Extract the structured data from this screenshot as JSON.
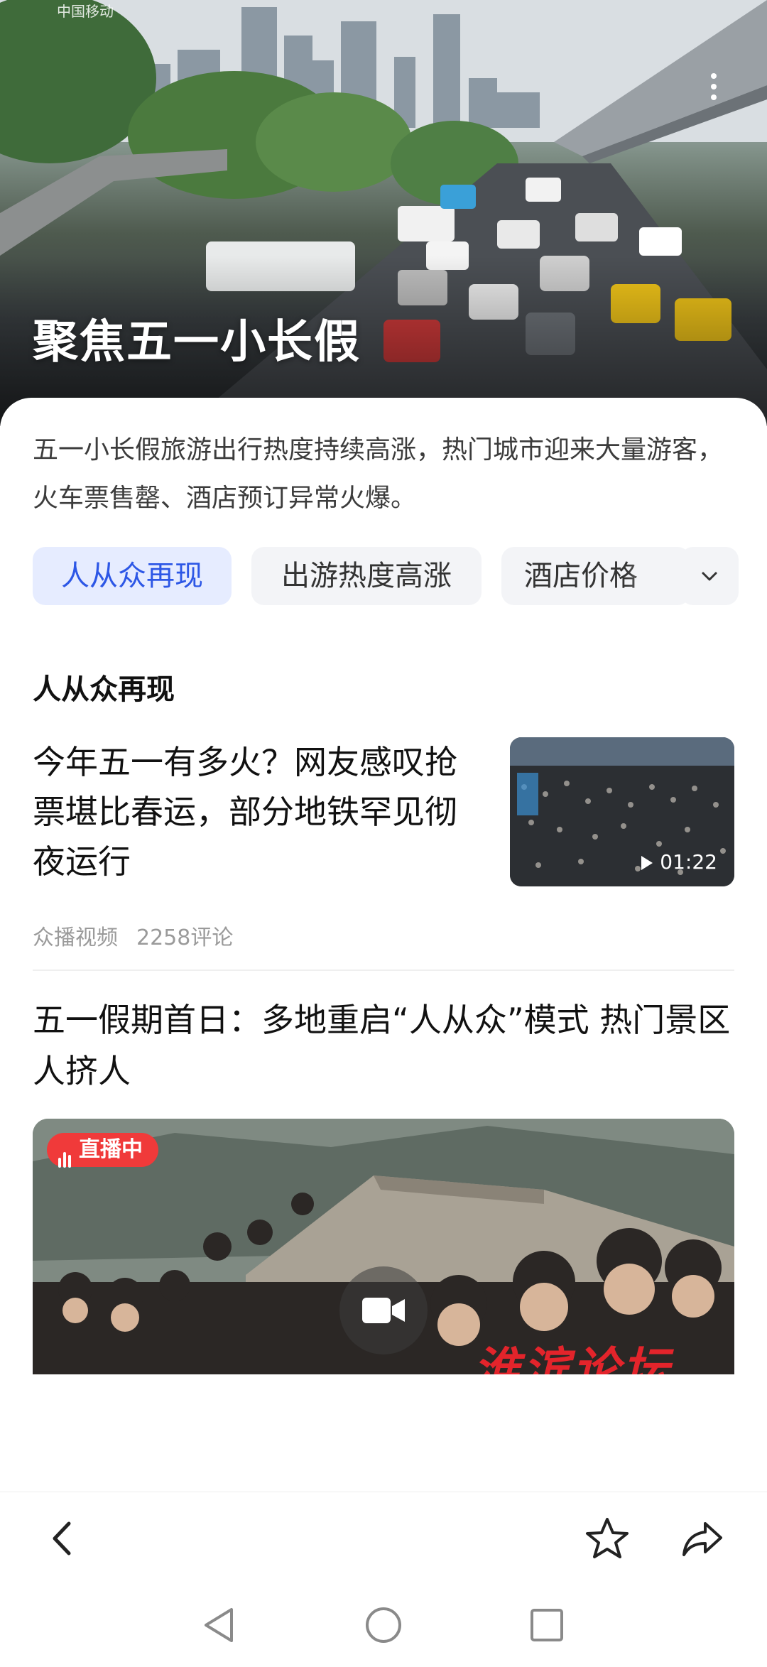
{
  "status_bar": {
    "carrier": "中国移动"
  },
  "hero": {
    "title": "聚焦五一小长假",
    "more_icon": "more-vertical-icon"
  },
  "summary": "五一小长假旅游出行热度持续高涨，热门城市迎来大量游客，火车票售罄、酒店预订异常火爆。",
  "tabs": [
    {
      "label": "人从众再现",
      "active": true
    },
    {
      "label": "出游热度高涨",
      "active": false
    },
    {
      "label": "酒店价格",
      "active": false
    }
  ],
  "tabs_toggle_icon": "chevron-down-icon",
  "section": {
    "title": "人从众再现"
  },
  "news": [
    {
      "title": "今年五一有多火？网友感叹抢票堪比春运，部分地铁罕见彻夜运行",
      "duration": "01:22",
      "source": "众播视频",
      "comments": "2258评论"
    },
    {
      "title": "五一假期首日：多地重启“人从众”模式 热门景区人挤人",
      "live_label": "直播中",
      "watermark": "淮滨论坛"
    }
  ],
  "bottom_bar": {
    "back_icon": "back-arrow-icon",
    "favorite_icon": "star-icon",
    "share_icon": "share-icon"
  },
  "system_nav": {
    "back": "nav-back-icon",
    "home": "nav-home-icon",
    "recents": "nav-recents-icon"
  },
  "colors": {
    "accent": "#2d57e6",
    "tab_active_bg": "#e6ecff",
    "tab_bg": "#f3f4f7",
    "live_red": "#f03a3a",
    "meta_gray": "#9a9a9a"
  }
}
